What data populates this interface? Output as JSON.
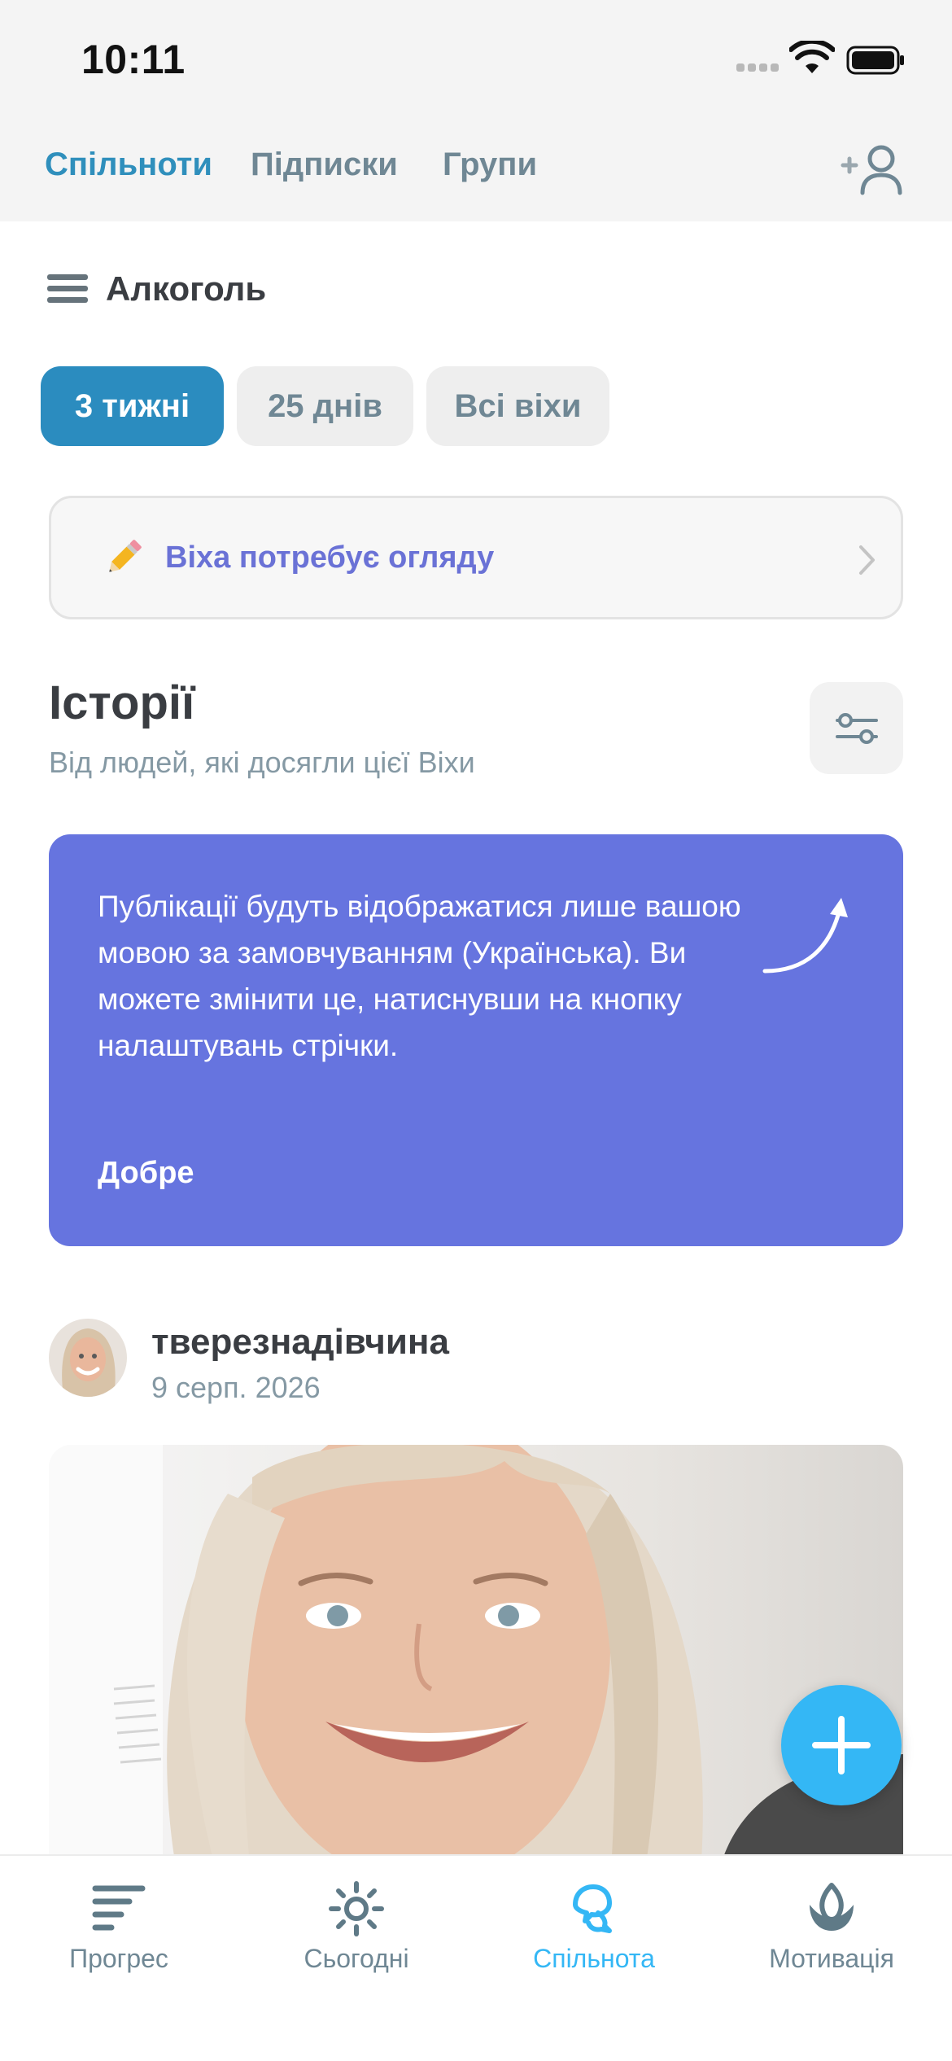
{
  "status_bar": {
    "time": "10:11"
  },
  "top_tabs": [
    {
      "label": "Спільноти",
      "active": true
    },
    {
      "label": "Підписки",
      "active": false
    },
    {
      "label": "Групи",
      "active": false
    }
  ],
  "section": {
    "title": "Алкоголь"
  },
  "milestone_chips": [
    {
      "label": "3 тижні",
      "active": true
    },
    {
      "label": "25 днів",
      "active": false
    },
    {
      "label": "Всі віхи",
      "active": false
    }
  ],
  "review_banner": {
    "text": "Віха потребує огляду",
    "icon": "pencil-icon"
  },
  "stories": {
    "title": "Історії",
    "subtitle": "Від людей, які досягли цієї Віхи"
  },
  "notice": {
    "text": "Публікації будуть відображатися лише вашою мовою за замовчуванням (Українська). Ви можете змінити це, натиснувши на кнопку налаштувань стрічки.",
    "ok_label": "Добре",
    "background": "#6674DF"
  },
  "post": {
    "username": "тверезнадівчина",
    "date": "9 серп. 2026"
  },
  "bottom_tabs": [
    {
      "label": "Прогрес",
      "icon": "progress-bars-icon",
      "active": false
    },
    {
      "label": "Сьогодні",
      "icon": "sun-icon",
      "active": false
    },
    {
      "label": "Спільнота",
      "icon": "community-icon",
      "active": true
    },
    {
      "label": "Мотивація",
      "icon": "lotus-icon",
      "active": false
    }
  ],
  "colors": {
    "accent": "#2B8CBF",
    "fab": "#34B7F5",
    "muted_text": "#6F8794"
  }
}
